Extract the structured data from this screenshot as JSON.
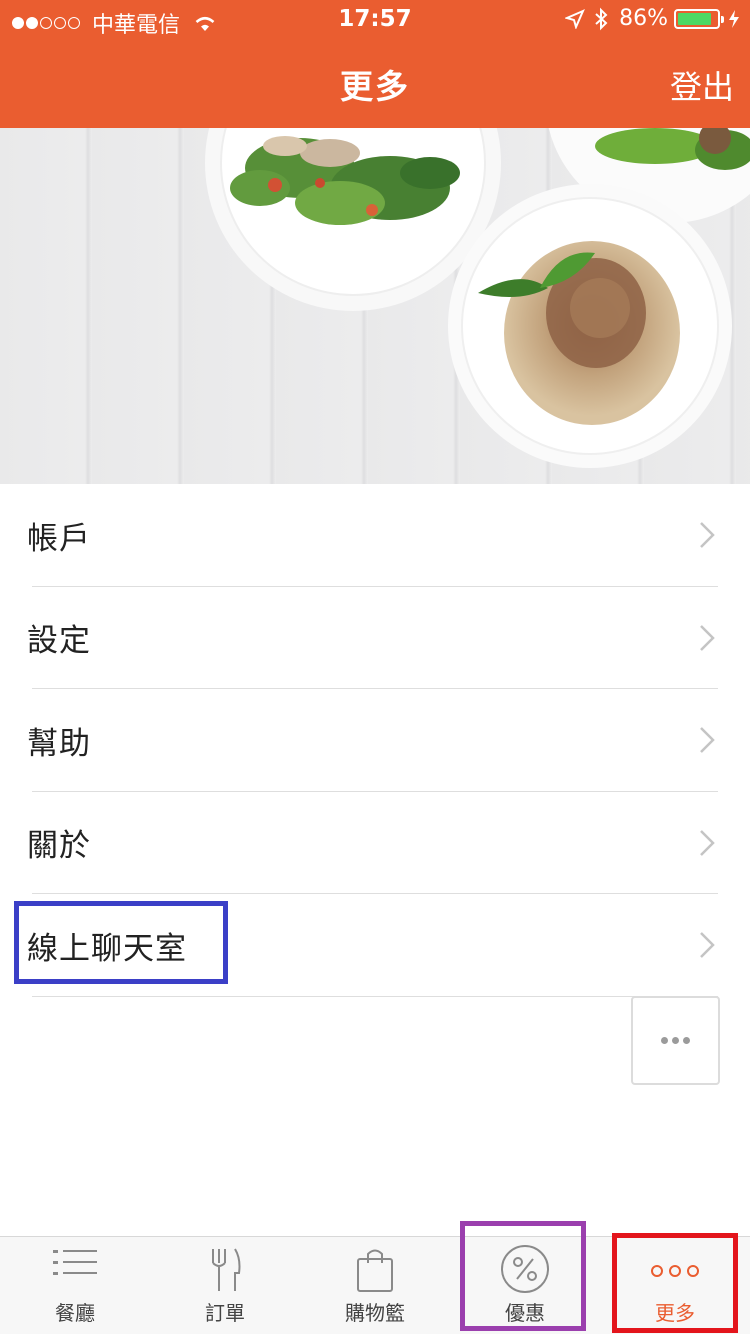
{
  "status_bar": {
    "carrier": "中華電信",
    "time": "17:57",
    "battery_percent": "86%",
    "battery_level": 0.86,
    "signal_bars_filled": 2,
    "signal_bars_total": 5
  },
  "header": {
    "title": "更多",
    "logout_label": "登出",
    "background_color": "#ea5d30"
  },
  "menu": {
    "items": [
      {
        "label": "帳戶"
      },
      {
        "label": "設定"
      },
      {
        "label": "幫助"
      },
      {
        "label": "關於"
      },
      {
        "label": "線上聊天室"
      }
    ]
  },
  "tabbar": {
    "tabs": [
      {
        "label": "餐廳",
        "icon": "list-icon"
      },
      {
        "label": "訂單",
        "icon": "fork-knife-icon"
      },
      {
        "label": "購物籃",
        "icon": "shopping-bag-icon"
      },
      {
        "label": "優惠",
        "icon": "percent-icon"
      },
      {
        "label": "更多",
        "icon": "more-icon"
      }
    ],
    "active_index": 4,
    "active_color": "#ea5d30"
  },
  "annotations": {
    "blue_box_color": "#3b3fc7",
    "purple_box_color": "#9b3fae",
    "red_box_color": "#e3151c"
  }
}
